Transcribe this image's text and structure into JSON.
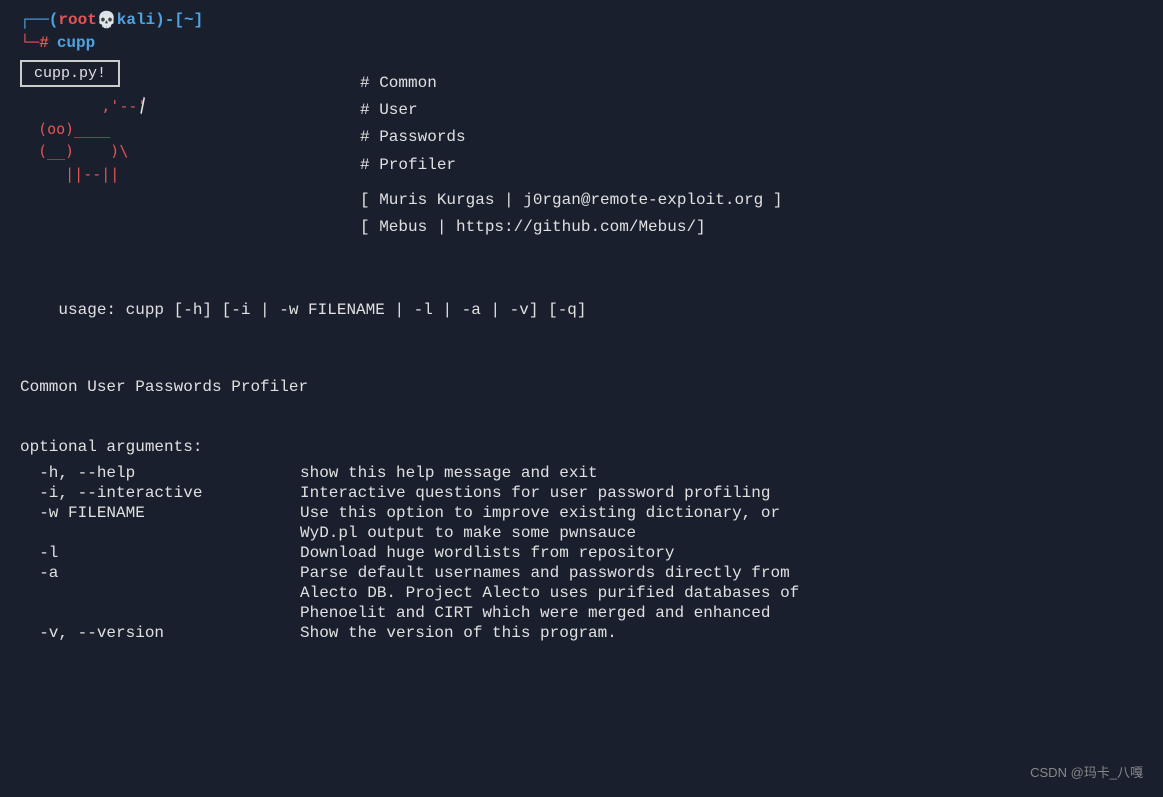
{
  "terminal": {
    "prompt": {
      "user": "root",
      "skull": "💀",
      "host": "kali",
      "path": "~",
      "command": "cupp"
    },
    "banner": {
      "cupp_label": "cupp.py!",
      "ascii_art_lines": [
        "         ,'--'",
        "  (oo)____",
        "  (__)    )\\",
        "     ||--||"
      ],
      "comment_lines": [
        "# Common",
        "# User",
        "# Passwords",
        "# Profiler"
      ],
      "author_lines": [
        "[ Muris Kurgas | j0rgan@remote-exploit.org ]",
        "[ Mebus | https://github.com/Mebus/]"
      ]
    },
    "usage": "usage: cupp [-h] [-i | -w FILENAME | -l | -a | -v] [-q]",
    "description": "Common User Passwords Profiler",
    "optional_args_header": "optional arguments:",
    "args": [
      {
        "flag": "  -h, --help",
        "desc": "show this help message and exit"
      },
      {
        "flag": "  -i, --interactive",
        "desc": "Interactive questions for user password profiling"
      },
      {
        "flag": "  -w FILENAME",
        "desc": "Use this option to improve existing dictionary, or"
      },
      {
        "flag": "",
        "desc": "WyD.pl output to make some pwnsauce"
      },
      {
        "flag": "  -l",
        "desc": "Download huge wordlists from repository"
      },
      {
        "flag": "  -a",
        "desc": "Parse default usernames and passwords directly from"
      },
      {
        "flag": "",
        "desc": "Alecto DB. Project Alecto uses purified databases of"
      },
      {
        "flag": "",
        "desc": "Phenoelit and CIRT which were merged and enhanced"
      },
      {
        "flag": "  -v, --version",
        "desc": "Show the version of this program."
      }
    ],
    "watermark": "CSDN @玛卡_八嘎"
  }
}
